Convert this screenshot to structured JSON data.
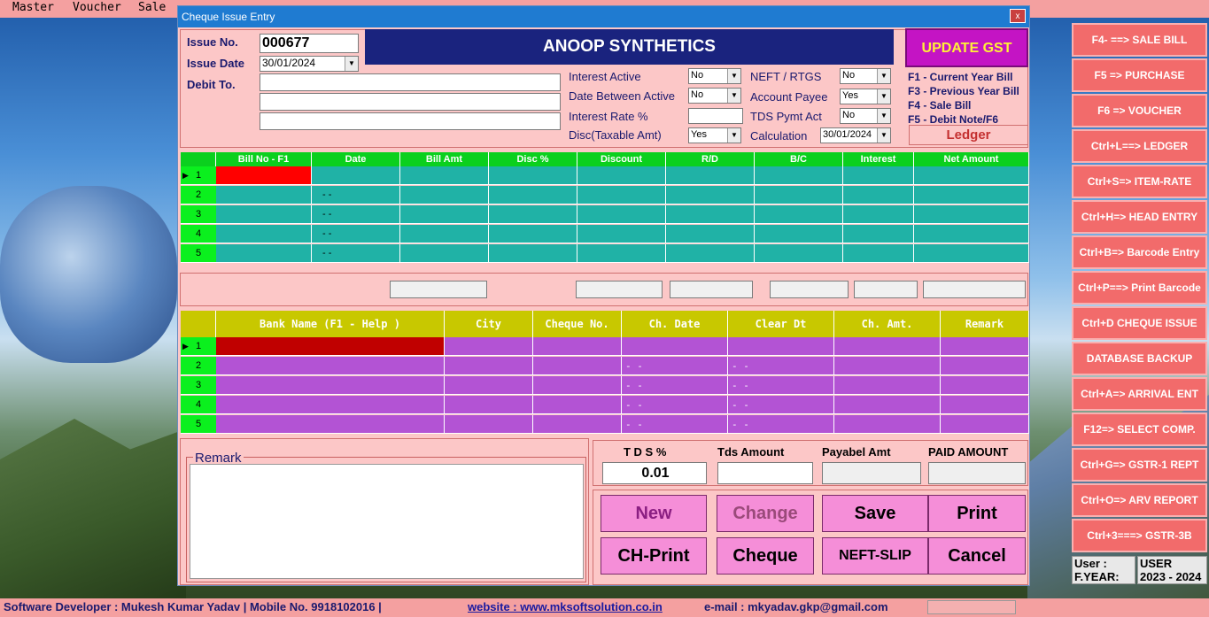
{
  "menu": [
    "Master",
    "Voucher",
    "Sale"
  ],
  "window": {
    "title": "Cheque  Issue Entry",
    "close": "x"
  },
  "form": {
    "issue_no_label": "Issue No.",
    "issue_no": "000677",
    "issue_date_label": "Issue Date",
    "issue_date": "30/01/2024",
    "debit_to_label": "Debit To.",
    "company": "ANOOP SYNTHETICS",
    "interest_active_label": "Interest Active",
    "interest_active": "No",
    "date_between_label": "Date Between Active",
    "date_between": "No",
    "interest_rate_label": "Interest Rate %",
    "disc_label": "Disc(Taxable Amt)",
    "disc": "Yes",
    "neft_label": "NEFT / RTGS",
    "neft": "No",
    "account_payee_label": "Account Payee",
    "account_payee": "Yes",
    "tds_pymt_label": "TDS Pymt Act",
    "tds_pymt": "No",
    "calculation_label": "Calculation",
    "calculation": "30/01/2024"
  },
  "update_gst": "UPDATE GST",
  "hints": [
    "F1 - Current Year Bill",
    "F3 - Previous Year Bill",
    "F4 - Sale Bill",
    "F5 - Debit Note/F6"
  ],
  "ledger": "Ledger",
  "bill_grid": {
    "headers": [
      "Bill No - F1",
      "Date",
      "Bill Amt",
      "Disc %",
      "Discount",
      "R/D",
      "B/C",
      "Interest",
      "Net Amount"
    ],
    "rows": [
      "1",
      "2",
      "3",
      "4",
      "5"
    ],
    "date_placeholder": "- -"
  },
  "bank_grid": {
    "headers": [
      "Bank Name  (F1 - Help )",
      "City",
      "Cheque No.",
      "Ch. Date",
      "Clear Dt",
      "Ch. Amt.",
      "Remark"
    ],
    "rows": [
      "1",
      "2",
      "3",
      "4",
      "5"
    ],
    "date_placeholder": "- -"
  },
  "remark_label": "Remark",
  "tds": {
    "tds_label": "T D S %",
    "tds_value": "0.01",
    "tds_amount_label": "Tds Amount",
    "payable_label": "Payabel Amt",
    "paid_label": "PAID AMOUNT"
  },
  "buttons": {
    "new": "New",
    "change": "Change",
    "save": "Save",
    "print": "Print",
    "chprint": "CH-Print",
    "cheque": "Cheque",
    "neft": "NEFT-SLIP",
    "cancel": "Cancel"
  },
  "sidebar": [
    "F4- ==> SALE BILL",
    "F5 => PURCHASE",
    "F6 => VOUCHER",
    "Ctrl+L==> LEDGER",
    "Ctrl+S=> ITEM-RATE",
    "Ctrl+H=> HEAD ENTRY",
    "Ctrl+B=> Barcode Entry",
    "Ctrl+P==> Print Barcode",
    "Ctrl+D CHEQUE ISSUE",
    "DATABASE BACKUP",
    "Ctrl+A=> ARRIVAL ENT",
    "F12=> SELECT COMP.",
    "Ctrl+G=> GSTR-1 REPT",
    "Ctrl+O=> ARV REPORT",
    "Ctrl+3===> GSTR-3B"
  ],
  "user": {
    "user_label": "User      :",
    "user_value": "USER",
    "fyear_label": "F.YEAR:",
    "fyear_value": "2023 - 2024"
  },
  "status": {
    "developer": "Software Developer :  Mukesh Kumar Yadav  |  Mobile No. 9918102016  |",
    "website": "website : www.mksoftsolution.co.in",
    "email": "e-mail : mkyadav.gkp@gmail.com"
  }
}
